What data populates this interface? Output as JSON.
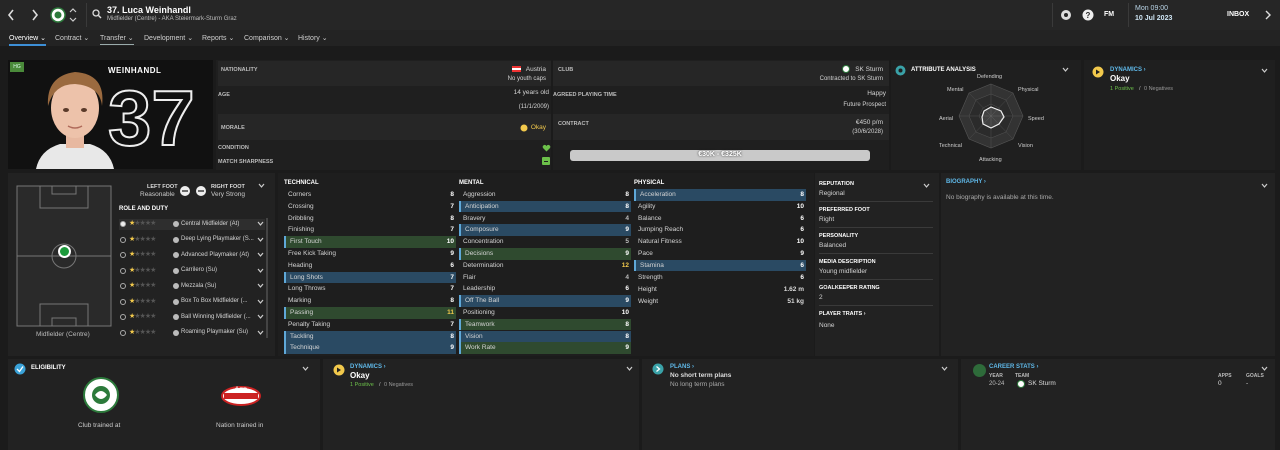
{
  "header": {
    "title": "37. Luca Weinhandl",
    "subtitle": "Midfielder (Centre) - AKA Steiermark-Sturm Graz",
    "clock": "Mon 09:00",
    "date": "10 Jul 2023",
    "fm_label": "FM",
    "inbox_label": "INBOX"
  },
  "nav": {
    "tabs": [
      {
        "label": "Overview ⌄"
      },
      {
        "label": "Contract ⌄"
      },
      {
        "label": "Transfer ⌄"
      },
      {
        "label": "Development ⌄"
      },
      {
        "label": "Reports ⌄"
      },
      {
        "label": "Comparison ⌄"
      },
      {
        "label": "History ⌄"
      }
    ]
  },
  "player": {
    "surname": "WEINHANDL",
    "number": "37",
    "badge": "HG",
    "nationality_label": "NATIONALITY",
    "nationality": "Austria",
    "youth_caps": "No youth caps",
    "age_label": "AGE",
    "age": "14 years old",
    "dob": "(11/1/2009)",
    "morale_label": "MORALE",
    "morale": "Okay",
    "condition_label": "CONDITION",
    "sharpness_label": "MATCH SHARPNESS",
    "club_label": "CLUB",
    "club": "SK Sturm",
    "club_contract": "Contracted to SK Sturm",
    "playing_time_label": "AGREED PLAYING TIME",
    "playing_time": "Happy",
    "playing_time_sub": "Future Prospect",
    "contract_label": "CONTRACT",
    "wage": "€450 p/m",
    "contract_end": "(30/6/2028)",
    "value": "€30K - €325K"
  },
  "attribute_analysis": {
    "title": "ATTRIBUTE ANALYSIS",
    "labels": [
      "Defending",
      "Physical",
      "Speed",
      "Vision",
      "Attacking",
      "Technical",
      "Aerial",
      "Mental"
    ]
  },
  "dynamics_top": {
    "title": "DYNAMICS ›",
    "status": "Okay",
    "positives": "1 Positive",
    "sep": "/",
    "negatives": "0 Negatives"
  },
  "feet": {
    "left_label": "LEFT FOOT",
    "left_value": "Reasonable",
    "right_label": "RIGHT FOOT",
    "right_value": "Very Strong"
  },
  "roles": {
    "title": "ROLE AND DUTY",
    "position": "Midfielder (Centre)",
    "items": [
      {
        "label": "Central Midfielder (At)"
      },
      {
        "label": "Deep Lying Playmaker (S..."
      },
      {
        "label": "Advanced Playmaker (At)"
      },
      {
        "label": "Carrilero (Su)"
      },
      {
        "label": "Mezzala (Su)"
      },
      {
        "label": "Box To Box Midfielder (..."
      },
      {
        "label": "Ball Winning Midfielder (..."
      },
      {
        "label": "Roaming Playmaker (Su)"
      }
    ]
  },
  "technical": {
    "title": "TECHNICAL",
    "rows": [
      {
        "name": "Corners",
        "value": "8"
      },
      {
        "name": "Crossing",
        "value": "7"
      },
      {
        "name": "Dribbling",
        "value": "8"
      },
      {
        "name": "Finishing",
        "value": "7"
      },
      {
        "name": "First Touch",
        "value": "10"
      },
      {
        "name": "Free Kick Taking",
        "value": "9"
      },
      {
        "name": "Heading",
        "value": "6"
      },
      {
        "name": "Long Shots",
        "value": "7"
      },
      {
        "name": "Long Throws",
        "value": "7"
      },
      {
        "name": "Marking",
        "value": "8"
      },
      {
        "name": "Passing",
        "value": "11"
      },
      {
        "name": "Penalty Taking",
        "value": "7"
      },
      {
        "name": "Tackling",
        "value": "8"
      },
      {
        "name": "Technique",
        "value": "9"
      }
    ]
  },
  "mental": {
    "title": "MENTAL",
    "rows": [
      {
        "name": "Aggression",
        "value": "8"
      },
      {
        "name": "Anticipation",
        "value": "8"
      },
      {
        "name": "Bravery",
        "value": "4"
      },
      {
        "name": "Composure",
        "value": "9"
      },
      {
        "name": "Concentration",
        "value": "5"
      },
      {
        "name": "Decisions",
        "value": "9"
      },
      {
        "name": "Determination",
        "value": "12"
      },
      {
        "name": "Flair",
        "value": "4"
      },
      {
        "name": "Leadership",
        "value": "6"
      },
      {
        "name": "Off The Ball",
        "value": "9"
      },
      {
        "name": "Positioning",
        "value": "10"
      },
      {
        "name": "Teamwork",
        "value": "8"
      },
      {
        "name": "Vision",
        "value": "8"
      },
      {
        "name": "Work Rate",
        "value": "9"
      }
    ]
  },
  "physical": {
    "title": "PHYSICAL",
    "rows": [
      {
        "name": "Acceleration",
        "value": "8"
      },
      {
        "name": "Agility",
        "value": "10"
      },
      {
        "name": "Balance",
        "value": "6"
      },
      {
        "name": "Jumping Reach",
        "value": "6"
      },
      {
        "name": "Natural Fitness",
        "value": "10"
      },
      {
        "name": "Pace",
        "value": "9"
      },
      {
        "name": "Stamina",
        "value": "6"
      },
      {
        "name": "Strength",
        "value": "6"
      }
    ],
    "height_label": "Height",
    "height": "1.62 m",
    "weight_label": "Weight",
    "weight": "51 kg"
  },
  "info": {
    "reputation_label": "REPUTATION",
    "reputation": "Regional",
    "preferred_foot_label": "PREFERRED FOOT",
    "preferred_foot": "Right",
    "personality_label": "PERSONALITY",
    "personality": "Balanced",
    "media_label": "MEDIA DESCRIPTION",
    "media": "Young midfielder",
    "gk_label": "GOALKEEPER RATING",
    "gk": "2",
    "traits_label": "PLAYER TRAITS ›",
    "traits": "None"
  },
  "biography": {
    "title": "BIOGRAPHY ›",
    "text": "No biography is available at this time."
  },
  "eligibility": {
    "title": "ELIGIBILITY",
    "club_trained": "Club trained at",
    "nation_trained": "Nation trained in",
    "ofb_text": "ÖFB"
  },
  "dynamics_bottom": {
    "title": "DYNAMICS ›",
    "status": "Okay",
    "positives": "1 Positive",
    "sep": "/",
    "negatives": "0 Negatives"
  },
  "plans": {
    "title": "PLANS ›",
    "short": "No short term plans",
    "long": "No long term plans"
  },
  "career": {
    "title": "CAREER STATS ›",
    "col_year": "YEAR",
    "col_team": "TEAM",
    "col_apps": "APPS",
    "col_goals": "GOALS",
    "year": "20-24",
    "team": "SK Sturm",
    "apps": "0",
    "goals": "-"
  },
  "colors": {
    "accent_blue": "#3d8fd6",
    "highlight_blue": "#2a4a63",
    "highlight_green": "#2f4a2f",
    "positive_green": "#6cc04a",
    "dynamics_yellow": "#f2c94c"
  },
  "icons": [
    "back-arrow-icon",
    "forward-arrow-icon",
    "club-crest-icon",
    "search-icon",
    "hint-icon",
    "help-icon",
    "chevron-down-icon",
    "heart-icon",
    "austria-flag-icon",
    "morale-face-icon"
  ]
}
